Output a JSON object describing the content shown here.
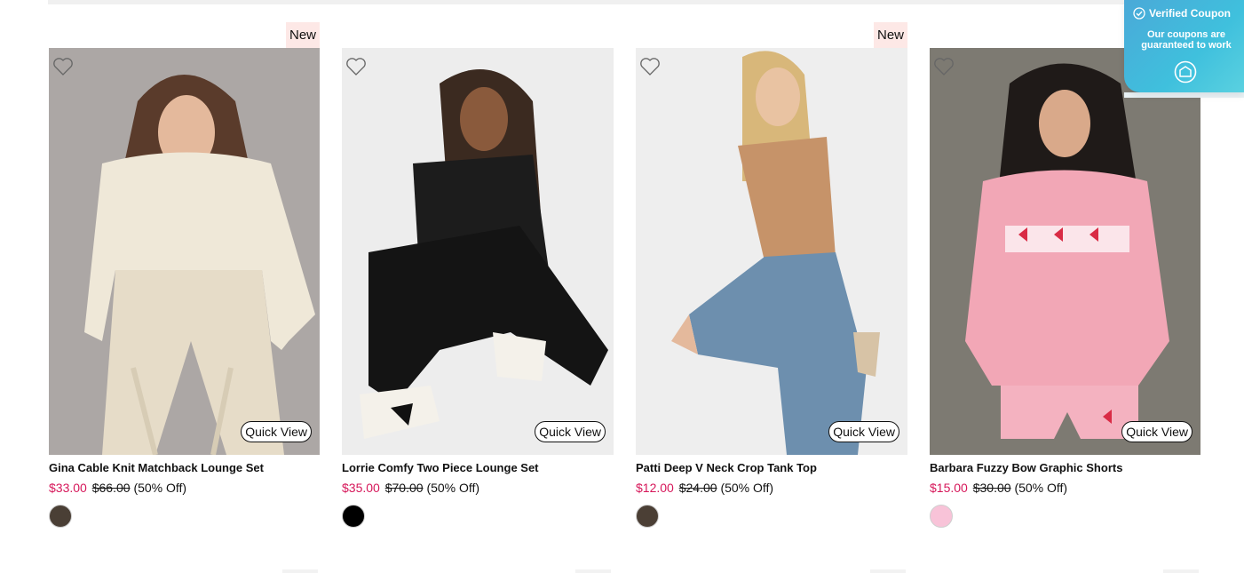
{
  "colors": {
    "sale_price": "#d6175a",
    "badge_bg": "#fde8e6",
    "coupon_gradient_start": "#4aa9d8",
    "coupon_gradient_end": "#5ad1e0"
  },
  "coupon_widget": {
    "title": "Verified Coupon",
    "text": "Our coupons are guaranteed to work",
    "icons": [
      "check-circle-icon",
      "coupon-brand-logo-icon"
    ]
  },
  "products": [
    {
      "badge": "New",
      "title": "Gina Cable Knit Matchback Lounge Set",
      "sale_price": "$33.00",
      "original_price": "$66.00",
      "discount": "(50% Off)",
      "quick_view": "Quick View",
      "swatch_color": "#4a3f35",
      "wishlist_icon": "heart-outline-icon"
    },
    {
      "badge": "",
      "title": "Lorrie Comfy Two Piece Lounge Set",
      "sale_price": "$35.00",
      "original_price": "$70.00",
      "discount": "(50% Off)",
      "quick_view": "Quick View",
      "swatch_color": "#000000",
      "wishlist_icon": "heart-outline-icon"
    },
    {
      "badge": "New",
      "title": "Patti Deep V Neck Crop Tank Top",
      "sale_price": "$12.00",
      "original_price": "$24.00",
      "discount": "(50% Off)",
      "quick_view": "Quick View",
      "swatch_color": "#4b3f35",
      "wishlist_icon": "heart-outline-icon"
    },
    {
      "badge": "",
      "title": "Barbara Fuzzy Bow Graphic Shorts",
      "sale_price": "$15.00",
      "original_price": "$30.00",
      "discount": "(50% Off)",
      "quick_view": "Quick View",
      "swatch_color": "#f8c3d8",
      "wishlist_icon": "heart-outline-icon"
    }
  ]
}
